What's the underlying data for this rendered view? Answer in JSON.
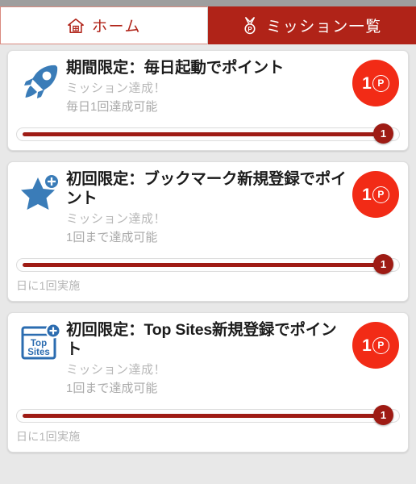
{
  "tabs": [
    {
      "id": "home",
      "label": "ホーム",
      "icon": "home-icon",
      "active": false
    },
    {
      "id": "mission",
      "label": "ミッション一覧",
      "icon": "medal-icon",
      "active": true
    }
  ],
  "colors": {
    "brand_red": "#b02318",
    "badge_red": "#f22b16",
    "progress_red": "#9e1b14",
    "icon_blue": "#3a7cb8",
    "page_bg": "#e8e8e8",
    "card_bg": "#ffffff",
    "muted_text": "#b5b5b5"
  },
  "missions": [
    {
      "icon": "rocket-icon",
      "title": "期間限定：毎日起動でポイント",
      "status": "ミッション達成！",
      "limit": "毎日1回達成可能",
      "points": "1",
      "points_unit": "P",
      "progress_value": "1",
      "progress_percent": 100,
      "footnote": ""
    },
    {
      "icon": "star-plus-icon",
      "title": "初回限定：ブックマーク新規登録でポイント",
      "status": "ミッション達成！",
      "limit": "1回まで達成可能",
      "points": "1",
      "points_unit": "P",
      "progress_value": "1",
      "progress_percent": 100,
      "footnote": "日に1回実施"
    },
    {
      "icon": "top-sites-icon",
      "title": "初回限定：Top Sites新規登録でポイント",
      "status": "ミッション達成！",
      "limit": "1回まで達成可能",
      "points": "1",
      "points_unit": "P",
      "progress_value": "1",
      "progress_percent": 100,
      "footnote": "日に1回実施"
    }
  ],
  "top_sites_icon_text": {
    "line1": "Top",
    "line2": "Sites"
  }
}
